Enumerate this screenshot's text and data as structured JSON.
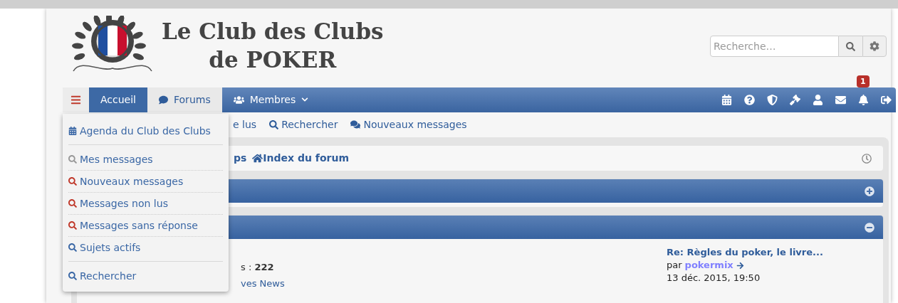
{
  "site": {
    "title_lines": [
      "Le Club des Clubs",
      "de POKER"
    ]
  },
  "search": {
    "placeholder": "Recherche…"
  },
  "nav": {
    "menu_open": true,
    "tabs": [
      {
        "label": "Accueil",
        "kind": "plain",
        "selected": false,
        "highlighted": true
      },
      {
        "label": "Forums",
        "kind": "forums",
        "selected": true,
        "highlighted": false
      },
      {
        "label": "Membres",
        "kind": "members",
        "selected": false,
        "highlighted": false
      }
    ],
    "icons": [
      {
        "kind": "calendar"
      },
      {
        "kind": "help"
      },
      {
        "kind": "shield"
      },
      {
        "kind": "gavel"
      },
      {
        "kind": "user"
      },
      {
        "kind": "mail"
      },
      {
        "kind": "bell",
        "badge": "1"
      },
      {
        "kind": "logout"
      }
    ]
  },
  "menu": {
    "groups": [
      [
        {
          "label": "Agenda du Club des Clubs",
          "kind": "calendar",
          "color": "#3a67a5"
        }
      ],
      [
        {
          "label": "Mes messages",
          "kind": "search",
          "color": "#999999"
        },
        {
          "label": "Nouveaux messages",
          "kind": "search",
          "color": "#c0392b"
        },
        {
          "label": "Messages non lus",
          "kind": "search",
          "color": "#c0392b"
        },
        {
          "label": "Messages sans réponse",
          "kind": "search",
          "color": "#c0392b"
        },
        {
          "label": "Sujets actifs",
          "kind": "search",
          "color": "#3a67a5"
        }
      ],
      [
        {
          "label": "Rechercher",
          "kind": "search",
          "color": "#3a67a5"
        }
      ]
    ]
  },
  "quick_links": [
    {
      "label": "e lus",
      "kind": "plain"
    },
    {
      "label": "Rechercher",
      "kind": "search"
    },
    {
      "label": "Nouveaux messages",
      "kind": "chat"
    }
  ],
  "breadcrumb": {
    "lead": "ps",
    "home": "Index du forum"
  },
  "categories": [
    {
      "expanded": false
    },
    {
      "expanded": true
    }
  ],
  "forum_row": {
    "stats_prefix": "s : ",
    "stats_value": "222",
    "subforum": "ves News",
    "last_post": {
      "title": "Re: Règles du poker, le livre...",
      "by": "par",
      "author": "pokermix",
      "date": "13 déc. 2015, 19:50"
    }
  }
}
